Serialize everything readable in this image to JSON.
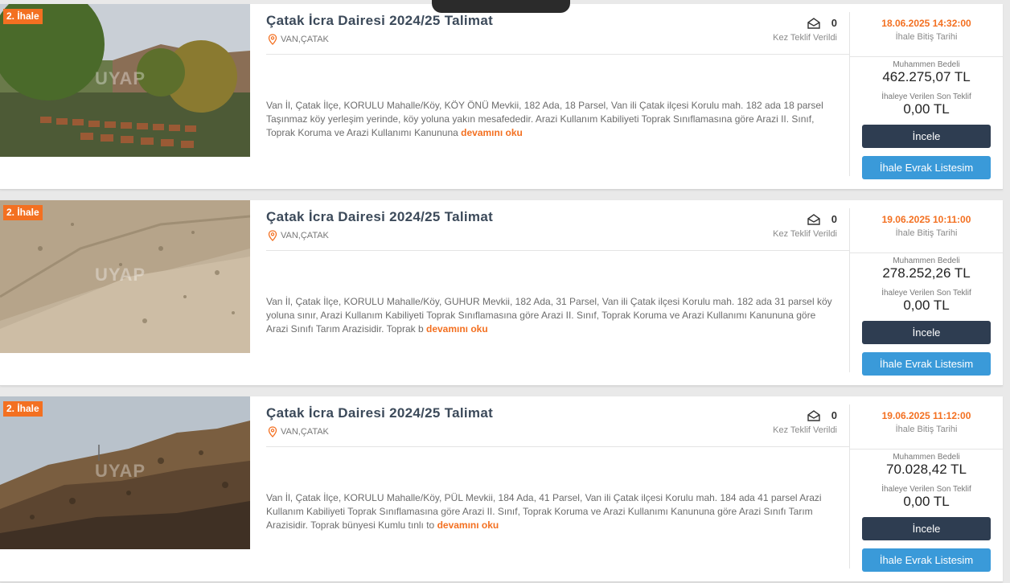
{
  "colors": {
    "accent": "#f37021",
    "dark_button": "#2e3d51",
    "blue_button": "#3a9ad9"
  },
  "listings": [
    {
      "badge": "2. İhale",
      "watermark": "UYAP",
      "title": "Çatak İcra Dairesi 2024/25 Talimat",
      "location": "VAN,ÇATAK",
      "offer_count": "0",
      "offer_label": "Kez Teklif Verildi",
      "description": "Van İl, Çatak İlçe, KORULU Mahalle/Köy, KÖY ÖNÜ Mevkii, 182 Ada, 18 Parsel, Van ili Çatak ilçesi Korulu mah. 182 ada 18 parsel Taşınmaz köy yerleşim yerinde, köy yoluna yakın mesafededir. Arazi Kullanım Kabiliyeti Toprak Sınıflamasına göre Arazi II. Sınıf, Toprak Koruma ve Arazi Kullanımı Kanununa",
      "more_link": "devamını oku",
      "end_date": "18.06.2025 14:32:00",
      "end_date_label": "İhale Bitiş Tarihi",
      "estimated_label": "Muhammen Bedeli",
      "estimated_value": "462.275,07 TL",
      "last_offer_label": "İhaleye Verilen Son Teklif",
      "last_offer_value": "0,00 TL",
      "inspect_button": "İncele",
      "documents_button": "İhale Evrak Listesim"
    },
    {
      "badge": "2. İhale",
      "watermark": "UYAP",
      "title": "Çatak İcra Dairesi 2024/25 Talimat",
      "location": "VAN,ÇATAK",
      "offer_count": "0",
      "offer_label": "Kez Teklif Verildi",
      "description": "Van İl, Çatak İlçe, KORULU Mahalle/Köy, GUHUR Mevkii, 182 Ada, 31 Parsel, Van ili Çatak ilçesi Korulu mah. 182 ada 31 parsel köy yoluna sınır, Arazi Kullanım Kabiliyeti Toprak Sınıflamasına göre Arazi II. Sınıf, Toprak Koruma ve Arazi Kullanımı Kanununa göre Arazi Sınıfı Tarım Arazisidir. Toprak b",
      "more_link": "devamını oku",
      "end_date": "19.06.2025 10:11:00",
      "end_date_label": "İhale Bitiş Tarihi",
      "estimated_label": "Muhammen Bedeli",
      "estimated_value": "278.252,26 TL",
      "last_offer_label": "İhaleye Verilen Son Teklif",
      "last_offer_value": "0,00 TL",
      "inspect_button": "İncele",
      "documents_button": "İhale Evrak Listesim"
    },
    {
      "badge": "2. İhale",
      "watermark": "UYAP",
      "title": "Çatak İcra Dairesi 2024/25 Talimat",
      "location": "VAN,ÇATAK",
      "offer_count": "0",
      "offer_label": "Kez Teklif Verildi",
      "description": "Van İl, Çatak İlçe, KORULU Mahalle/Köy, PÜL Mevkii, 184 Ada, 41 Parsel, Van ili Çatak ilçesi Korulu mah. 184 ada 41 parsel Arazi Kullanım Kabiliyeti Toprak Sınıflamasına göre Arazi II. Sınıf, Toprak Koruma ve Arazi Kullanımı Kanununa göre Arazi Sınıfı Tarım Arazisidir. Toprak bünyesi Kumlu tınlı to",
      "more_link": "devamını oku",
      "end_date": "19.06.2025 11:12:00",
      "end_date_label": "İhale Bitiş Tarihi",
      "estimated_label": "Muhammen Bedeli",
      "estimated_value": "70.028,42 TL",
      "last_offer_label": "İhaleye Verilen Son Teklif",
      "last_offer_value": "0,00 TL",
      "inspect_button": "İncele",
      "documents_button": "İhale Evrak Listesim"
    }
  ]
}
